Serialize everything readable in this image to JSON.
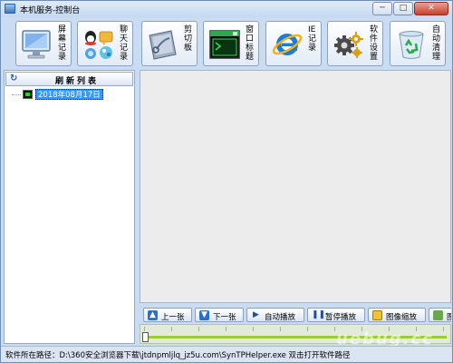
{
  "window": {
    "title": "本机服务-控制台",
    "minimize_glyph": "─",
    "maximize_glyph": "□",
    "close_glyph": "✕"
  },
  "toolbar": {
    "buttons": [
      {
        "label": "屏幕记录",
        "icon": "monitor-icon"
      },
      {
        "label": "聊天记录",
        "icon": "chat-apps-icon"
      },
      {
        "label": "剪切板",
        "icon": "clipboard-icon"
      },
      {
        "label": "窗口标题",
        "icon": "terminal-window-icon"
      },
      {
        "label": "IE记录",
        "icon": "ie-browser-icon"
      },
      {
        "label": "软件设置",
        "icon": "gears-icon"
      },
      {
        "label": "自动清理",
        "icon": "recycle-bin-icon"
      }
    ]
  },
  "left_panel": {
    "refresh_label": "刷新列表",
    "tree_items": [
      "2018年08月17日"
    ]
  },
  "nav": {
    "prev_label": "上一张",
    "next_label": "下一张",
    "autoplay_label": "自动播放",
    "pause_label": "暂停播放",
    "zoom_label": "图像缩放",
    "extra_label": "图"
  },
  "slider": {
    "position": 0
  },
  "status": {
    "path_text": "软件所在路径：D:\\360安全浏览器下载\\jtdnpmljlq_jz5u.com\\SynTPHelper.exe 双击打开软件路径"
  },
  "watermark": "uebug.cc",
  "colors": {
    "window_bg": "#c9dcf2",
    "selection": "#3399ff",
    "slider_track": "#9acd32",
    "close_button": "#c6402c"
  }
}
